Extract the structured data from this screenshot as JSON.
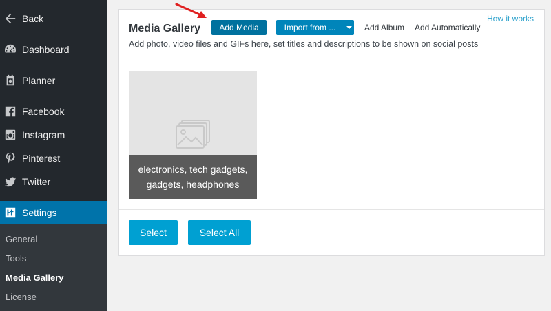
{
  "sidebar": {
    "items": [
      {
        "label": "Back",
        "icon": "arrow-left-icon"
      },
      {
        "label": "Dashboard",
        "icon": "dashboard-icon"
      },
      {
        "label": "Planner",
        "icon": "planner-icon"
      },
      {
        "label": "Facebook",
        "icon": "facebook-icon"
      },
      {
        "label": "Instagram",
        "icon": "instagram-icon"
      },
      {
        "label": "Pinterest",
        "icon": "pinterest-icon"
      },
      {
        "label": "Twitter",
        "icon": "twitter-icon"
      },
      {
        "label": "Settings",
        "icon": "settings-icon",
        "active": true
      }
    ],
    "subitems": [
      {
        "label": "General"
      },
      {
        "label": "Tools"
      },
      {
        "label": "Media Gallery",
        "current": true
      },
      {
        "label": "License"
      }
    ]
  },
  "panel": {
    "title": "Media Gallery",
    "description": "Add photo, video files and GIFs here, set titles and descriptions to be shown on social posts",
    "add_media": "Add Media",
    "import_from": "Import from ...",
    "add_album": "Add Album",
    "add_automatically": "Add Automatically",
    "how_it_works": "How it works",
    "media_items": [
      {
        "caption": "electronics, tech gadgets, gadgets, headphones",
        "icon": "image-placeholder-icon"
      }
    ],
    "select": "Select",
    "select_all": "Select All"
  },
  "colors": {
    "sidebar_bg": "#23282d",
    "active_bg": "#0073aa",
    "button_blue": "#0085ba",
    "select_blue": "#00a0d2",
    "link_blue": "#2ea2cc",
    "arrow_red": "#e02020"
  }
}
